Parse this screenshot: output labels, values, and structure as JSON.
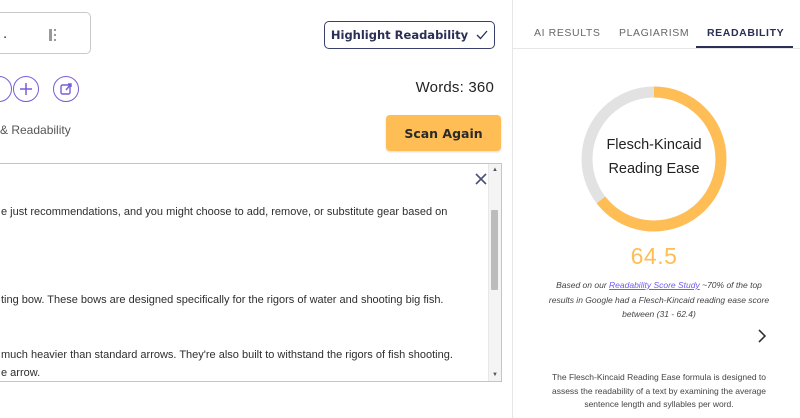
{
  "toolbar": {
    "title_value": ".",
    "highlight_label": "Highlight Readability",
    "words_label": "Words: 360",
    "section_label": "& Readability",
    "scan_label": "Scan Again"
  },
  "icons": [
    "move-icon",
    "check-icon",
    "plus-icon",
    "share-icon",
    "close-icon",
    "chevron-right-icon"
  ],
  "editor": {
    "lines": [
      "e just recommendations, and you might choose to add, remove, or substitute gear based on",
      "ting bow. These bows are designed specifically for the rigors of water and shooting big fish.",
      "much heavier than standard arrows. They're also built to withstand the rigors of fish shooting.",
      "e arrow."
    ]
  },
  "tabs": [
    {
      "label": "AI RESULTS",
      "active": false
    },
    {
      "label": "PLAGIARISM",
      "active": false
    },
    {
      "label": "READABILITY",
      "active": true
    }
  ],
  "readability": {
    "metric_line1": "Flesch-Kincaid",
    "metric_line2": "Reading Ease",
    "score": "64.5",
    "score_fraction": 0.645,
    "note_prefix": "Based on our ",
    "note_link": "Readability Score Study",
    "note_line1_rest": " ~70% of the top",
    "note_line2": "results in Google had a Flesch-Kincaid reading ease score",
    "note_line3": "between (31 - 62.4)",
    "desc_line1": "The Flesch-Kincaid Reading Ease formula is designed to",
    "desc_line2": "assess the readability of a text by examining the average",
    "desc_line3": "sentence length and syllables per word."
  },
  "colors": {
    "accent": "#ffbe55",
    "primary": "#2b2f55",
    "tool_purple": "#7b5cd6",
    "gauge_track": "#e2e2e2",
    "link": "#6f5cf0"
  }
}
